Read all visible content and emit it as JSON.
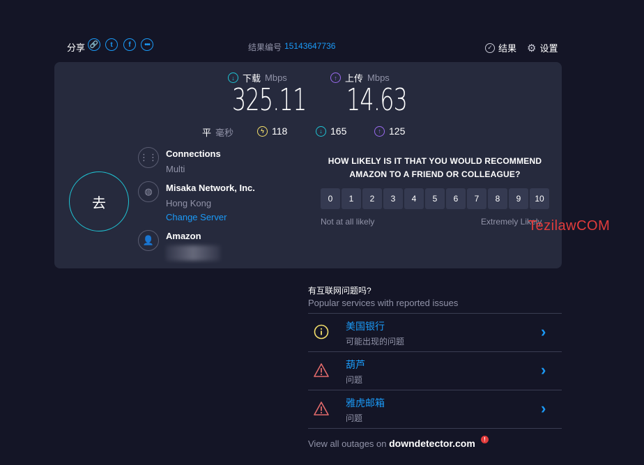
{
  "share": {
    "label": "分享",
    "icons": [
      "link-icon",
      "twitter-icon",
      "facebook-icon",
      "more-icon"
    ]
  },
  "result": {
    "id_label": "结果编号",
    "id": "15143647736"
  },
  "top_nav": {
    "results": "结果",
    "settings": "设置"
  },
  "metrics": {
    "download": {
      "label": "下载",
      "unit": "Mbps",
      "value": "325.11"
    },
    "upload": {
      "label": "上传",
      "unit": "Mbps",
      "value": "14.63"
    }
  },
  "ping": {
    "label": "平",
    "unit": "毫秒",
    "idle": "118",
    "download": "165",
    "upload": "125"
  },
  "go_button": "去",
  "connections": {
    "title": "Connections",
    "value": "Multi"
  },
  "server": {
    "isp": "Misaka Network, Inc.",
    "location": "Hong Kong",
    "change_link": "Change Server"
  },
  "host": {
    "name": "Amazon"
  },
  "survey": {
    "question": "HOW LIKELY IS IT THAT YOU WOULD RECOMMEND AMAZON TO A FRIEND OR COLLEAGUE?",
    "scale": [
      "0",
      "1",
      "2",
      "3",
      "4",
      "5",
      "6",
      "7",
      "8",
      "9",
      "10"
    ],
    "low_label": "Not at all likely",
    "high_label": "Extremely Likely"
  },
  "watermark": "TezilawCOM",
  "outages": {
    "heading": "有互联网问题吗?",
    "subheading": "Popular services with reported issues",
    "services": [
      {
        "name": "美国银行",
        "status": "可能出现的问题",
        "icon": "info-icon"
      },
      {
        "name": "葫芦",
        "status": "问题",
        "icon": "warning-icon"
      },
      {
        "name": "雅虎邮箱",
        "status": "问题",
        "icon": "warning-icon"
      }
    ],
    "footer_prefix": "View all outages on ",
    "footer_site": "downdetector.com"
  },
  "colors": {
    "accent": "#1b9af7",
    "download": "#1fc4d4",
    "upload": "#9b6bf0",
    "ping": "#f5e06b",
    "warning": "#e26b6b"
  }
}
